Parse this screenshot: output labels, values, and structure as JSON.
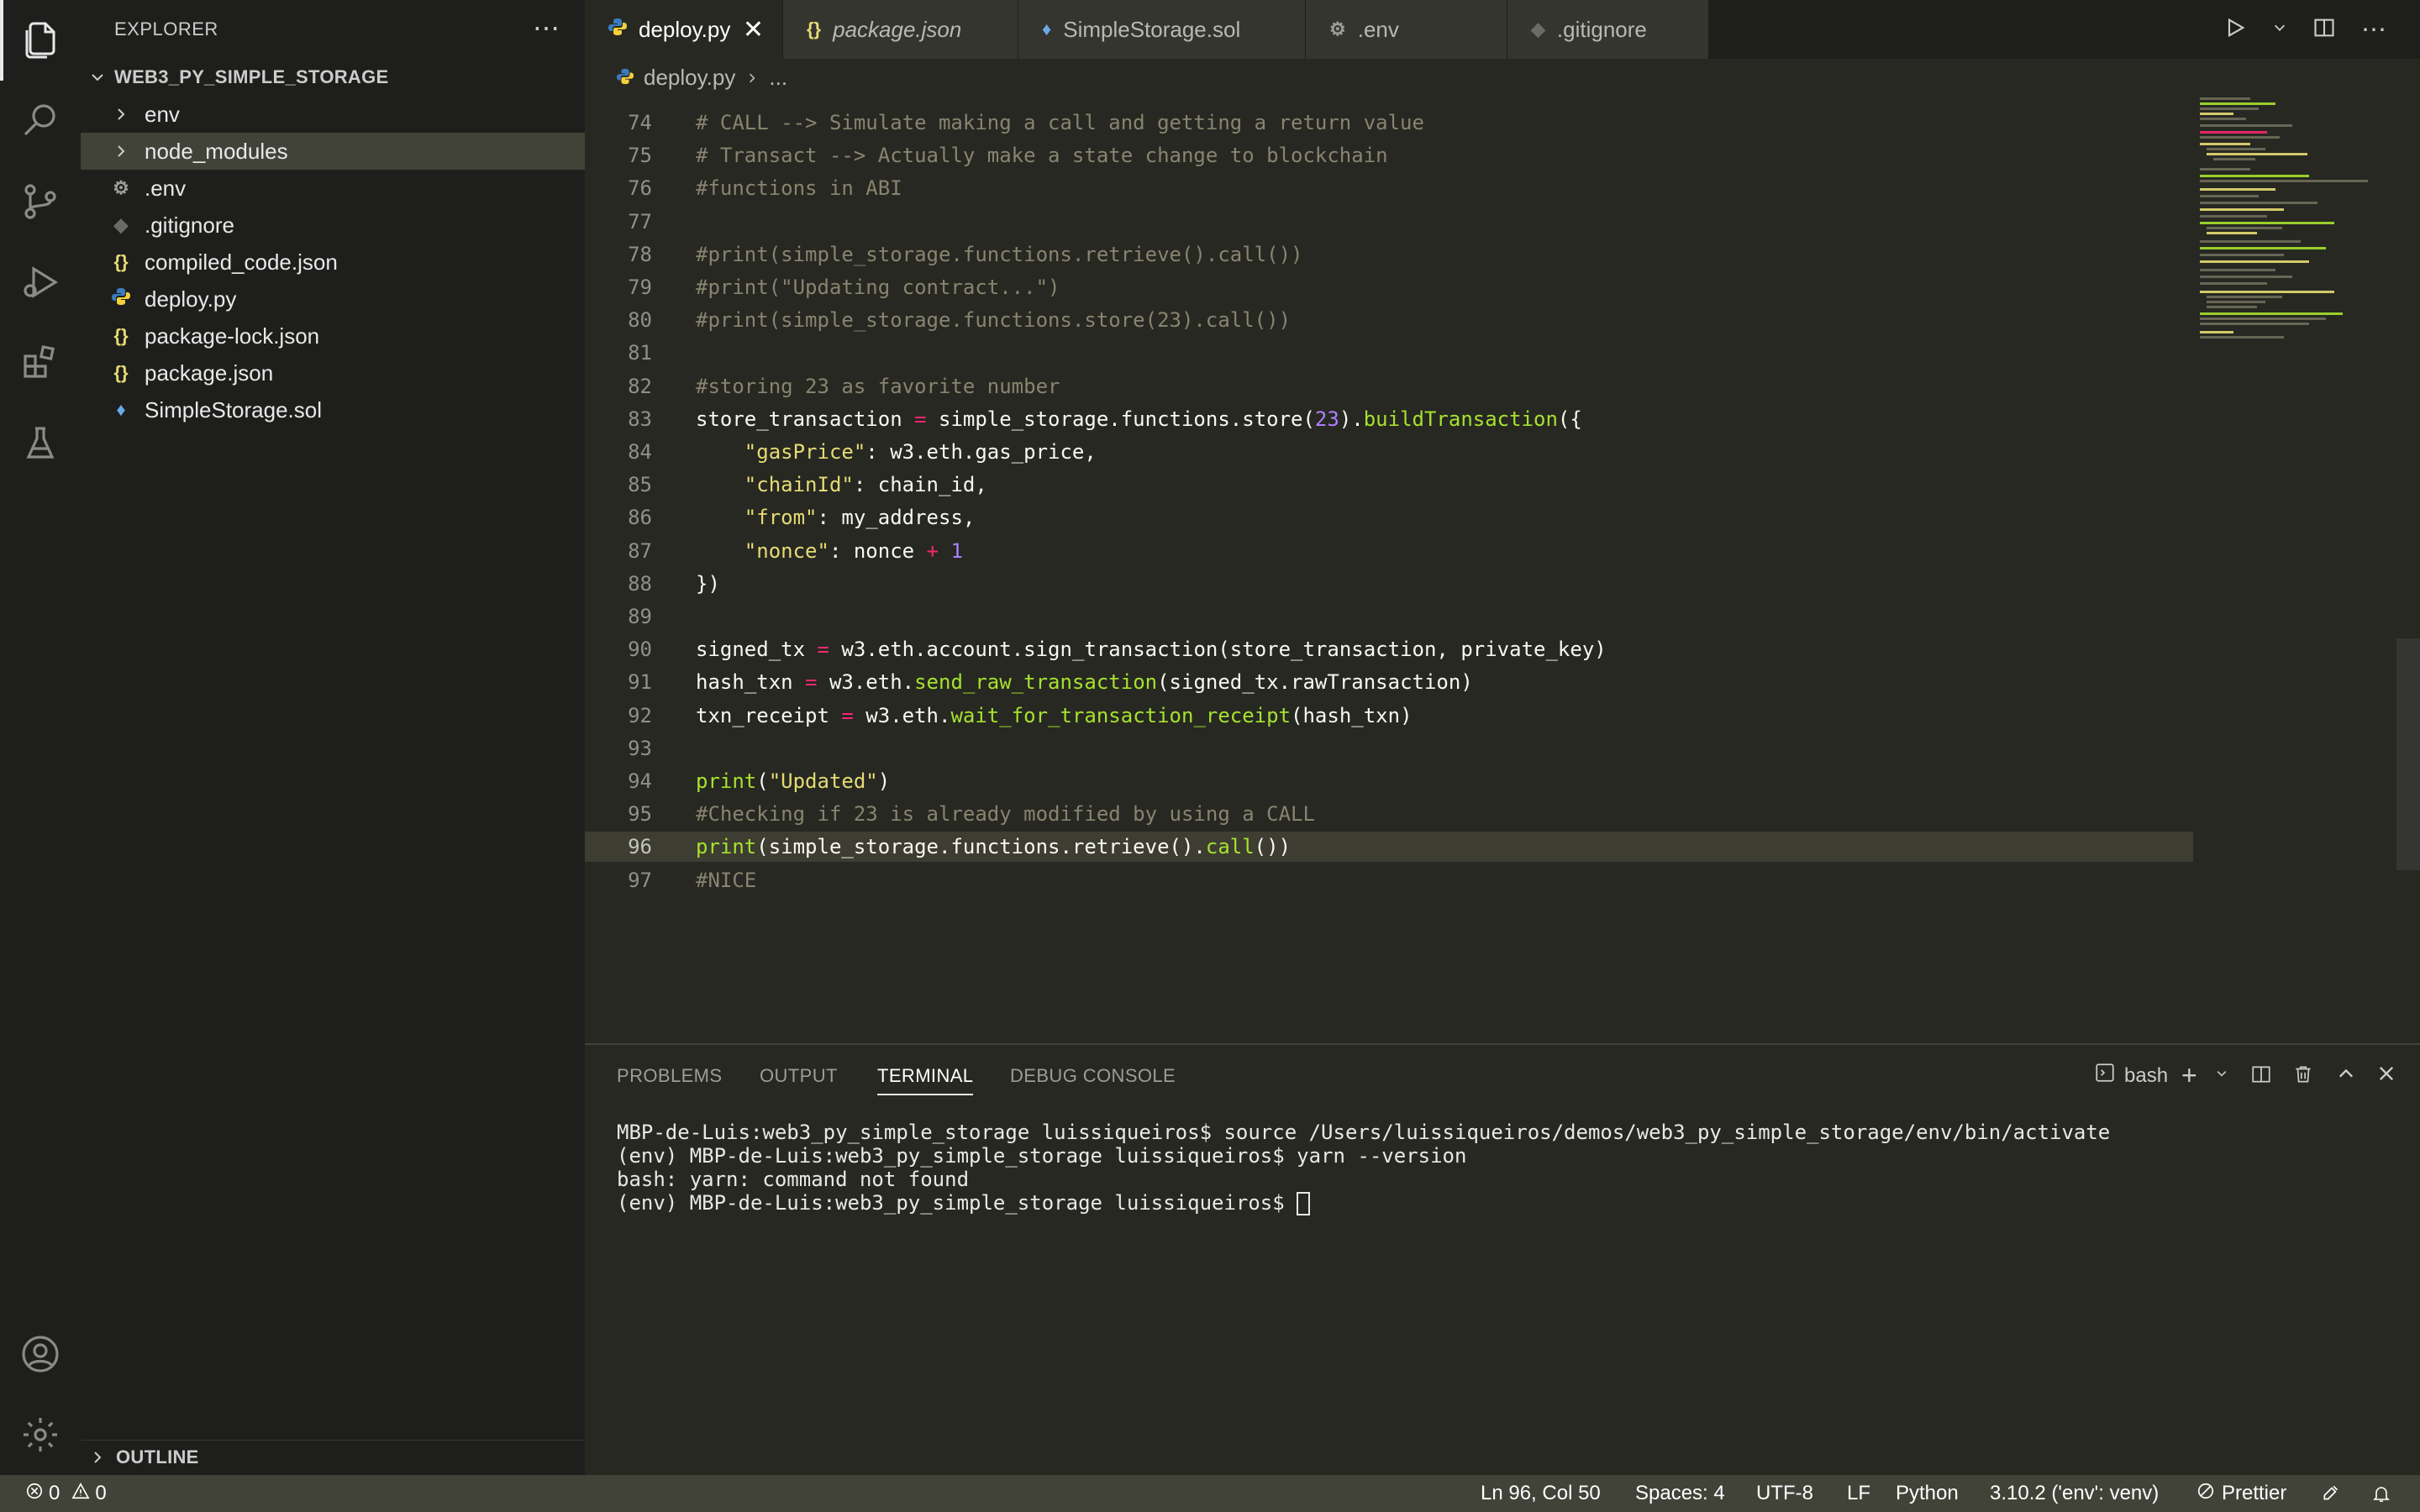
{
  "sidebar": {
    "title": "EXPLORER",
    "project": "WEB3_PY_SIMPLE_STORAGE",
    "items": [
      {
        "label": "env",
        "kind": "folder"
      },
      {
        "label": "node_modules",
        "kind": "folder"
      },
      {
        "label": ".env",
        "kind": "gear"
      },
      {
        "label": ".gitignore",
        "kind": "diamond"
      },
      {
        "label": "compiled_code.json",
        "kind": "json"
      },
      {
        "label": "deploy.py",
        "kind": "python"
      },
      {
        "label": "package-lock.json",
        "kind": "json"
      },
      {
        "label": "package.json",
        "kind": "json"
      },
      {
        "label": "SimpleStorage.sol",
        "kind": "solidity"
      }
    ],
    "outline": "OUTLINE"
  },
  "tabs": [
    {
      "label": "deploy.py",
      "icon": "python-icon",
      "active": true
    },
    {
      "label": "package.json",
      "icon": "json-icon",
      "italic": true
    },
    {
      "label": "SimpleStorage.sol",
      "icon": "solidity-icon"
    },
    {
      "label": ".env",
      "icon": "gear-icon"
    },
    {
      "label": ".gitignore",
      "icon": "git-icon"
    }
  ],
  "breadcrumb": {
    "file": "deploy.py",
    "rest": "..."
  },
  "editor": {
    "current_line": "96",
    "lines": [
      {
        "n": "74",
        "text": "# CALL --> Simulate making a call and getting a return value"
      },
      {
        "n": "75",
        "text": "# Transact --> Actually make a state change to blockchain"
      },
      {
        "n": "76",
        "text": "#functions in ABI"
      },
      {
        "n": "77",
        "text": ""
      },
      {
        "n": "78",
        "text": "#print(simple_storage.functions.retrieve().call())"
      },
      {
        "n": "79",
        "text": "#print(\"Updating contract...\")"
      },
      {
        "n": "80",
        "text": "#print(simple_storage.functions.store(23).call())"
      },
      {
        "n": "81",
        "text": ""
      },
      {
        "n": "82",
        "text": "#storing 23 as favorite number"
      },
      {
        "n": "83",
        "text": "store_transaction = simple_storage.functions.store(23).buildTransaction({"
      },
      {
        "n": "84",
        "text": "    \"gasPrice\": w3.eth.gas_price,"
      },
      {
        "n": "85",
        "text": "    \"chainId\": chain_id,"
      },
      {
        "n": "86",
        "text": "    \"from\": my_address,"
      },
      {
        "n": "87",
        "text": "    \"nonce\": nonce + 1"
      },
      {
        "n": "88",
        "text": "})"
      },
      {
        "n": "89",
        "text": ""
      },
      {
        "n": "90",
        "text": "signed_tx = w3.eth.account.sign_transaction(store_transaction, private_key)"
      },
      {
        "n": "91",
        "text": "hash_txn = w3.eth.send_raw_transaction(signed_tx.rawTransaction)"
      },
      {
        "n": "92",
        "text": "txn_receipt = w3.eth.wait_for_transaction_receipt(hash_txn)"
      },
      {
        "n": "93",
        "text": ""
      },
      {
        "n": "94",
        "text": "print(\"Updated\")"
      },
      {
        "n": "95",
        "text": "#Checking if 23 is already modified by using a CALL"
      },
      {
        "n": "96",
        "text": "print(simple_storage.functions.retrieve().call())"
      },
      {
        "n": "97",
        "text": "#NICE"
      }
    ]
  },
  "panel": {
    "tabs": [
      "PROBLEMS",
      "OUTPUT",
      "TERMINAL",
      "DEBUG CONSOLE"
    ],
    "active_tab": "TERMINAL",
    "shell": "bash",
    "terminal_lines": [
      "MBP-de-Luis:web3_py_simple_storage luissiqueiros$ source /Users/luissiqueiros/demos/web3_py_simple_storage/env/bin/activate",
      "(env) MBP-de-Luis:web3_py_simple_storage luissiqueiros$ yarn --version",
      "bash: yarn: command not found",
      "(env) MBP-de-Luis:web3_py_simple_storage luissiqueiros$ "
    ]
  },
  "statusbar": {
    "errors": "0",
    "warnings": "0",
    "position": "Ln 96, Col 50",
    "spaces": "Spaces: 4",
    "encoding": "UTF-8",
    "eol": "LF",
    "language": "Python",
    "interpreter": "3.10.2 ('env': venv)",
    "formatter": "Prettier"
  },
  "colors": {
    "accent_folder_selected": "#414339",
    "statusbar": "#414339",
    "editor_bg": "#272822"
  }
}
